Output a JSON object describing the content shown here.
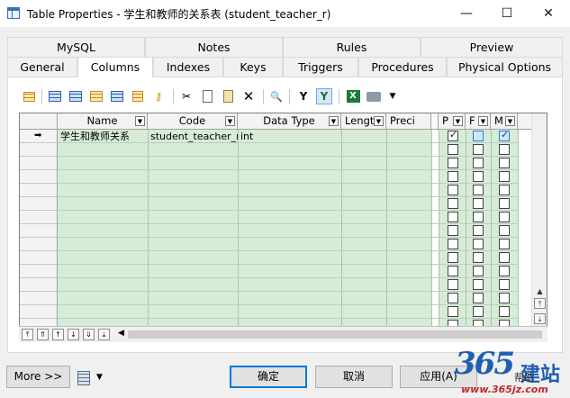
{
  "window": {
    "title": "Table Properties - 学生和教师的关系表 (student_teacher_r)",
    "minimize": "—",
    "maximize": "☐",
    "close": "✕"
  },
  "tabs_row1": [
    {
      "label": "MySQL"
    },
    {
      "label": "Notes"
    },
    {
      "label": "Rules"
    },
    {
      "label": "Preview"
    }
  ],
  "tabs_row2": [
    {
      "label": "General"
    },
    {
      "label": "Columns",
      "active": true
    },
    {
      "label": "Indexes"
    },
    {
      "label": "Keys"
    },
    {
      "label": "Triggers"
    },
    {
      "label": "Procedures"
    },
    {
      "label": "Physical Options"
    }
  ],
  "toolbar": {
    "icons": [
      "properties-icon",
      "add-row-icon",
      "insert-row-icon",
      "add-columns-icon",
      "reuse-columns-icon",
      "new-domain-icon",
      "key-icon",
      "cut-icon",
      "copy-icon",
      "paste-icon",
      "delete-icon",
      "find-icon",
      "filter-icon",
      "filter-active-icon",
      "excel-icon",
      "print-icon"
    ],
    "cut": "✂",
    "delete": "✕",
    "find": "🔍",
    "filter": "Y",
    "excel": "X",
    "print_dropdown": "▼"
  },
  "grid": {
    "columns": [
      "Name",
      "Code",
      "Data Type",
      "Lengt",
      "Preci",
      "P",
      "F",
      "M"
    ],
    "rows": [
      {
        "name": "学生和教师关系",
        "code": "student_teacher_r",
        "data_type": "int",
        "length": "",
        "precision": "",
        "p": true,
        "f": false,
        "m": true
      }
    ],
    "current_row_marker": "➡",
    "empty_rows": 15
  },
  "navigation": [
    "⤒",
    "⇑",
    "↑",
    "↓",
    "⇓",
    "⤓"
  ],
  "scroll": {
    "up": "▲",
    "down": "▼",
    "left": "◀",
    "top": "⤒",
    "bottom": "⤓"
  },
  "buttons": {
    "more": "More >>",
    "ok": "确定",
    "cancel": "取消",
    "apply": "应用(A)",
    "db_dropdown": "▼"
  },
  "watermark": {
    "brand_number": "365",
    "brand_text": "建站",
    "help": "帮助",
    "url": "www.365jz.com"
  }
}
